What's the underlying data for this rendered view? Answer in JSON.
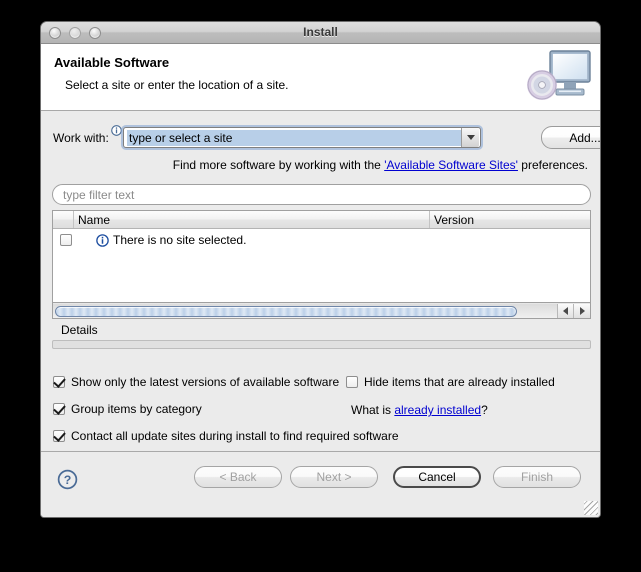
{
  "window": {
    "title": "Install",
    "traffic_lights": [
      "close-button",
      "minimize-button",
      "zoom-button"
    ]
  },
  "banner": {
    "title": "Available Software",
    "subtitle": "Select a site or enter the location of a site.",
    "icon": "computer-disc-icon"
  },
  "work_with": {
    "label": "Work with:",
    "info_icon": "info-icon",
    "combo_value": "type or select a site",
    "combo_placeholder": "type or select a site",
    "dropdown_icon": "chevron-down-icon",
    "add_button": "Add..."
  },
  "hint": {
    "before": "Find more software by working with the ",
    "link": "'Available Software Sites'",
    "after": " preferences."
  },
  "filter": {
    "placeholder": "type filter text",
    "value": ""
  },
  "table": {
    "columns": [
      "",
      "Name",
      "Version"
    ],
    "rows": [
      {
        "checked": false,
        "icon": "info-icon",
        "name": "There is no site selected.",
        "version": ""
      }
    ]
  },
  "scrollbar": {
    "left_arrow": "scroll-left-icon",
    "right_arrow": "scroll-right-icon"
  },
  "details": {
    "label": "Details",
    "value": ""
  },
  "options": [
    {
      "label": "Show only the latest versions of available software",
      "checked": true
    },
    {
      "label": "Group items by category",
      "checked": true
    },
    {
      "label": "Contact all update sites during install to find required software",
      "checked": true
    },
    {
      "label": "Hide items that are already installed",
      "checked": false
    }
  ],
  "what_is": {
    "before": "What is ",
    "link": "already installed",
    "after": "?"
  },
  "footer": {
    "help_icon": "help-question-icon",
    "back": "< Back",
    "next": "Next >",
    "cancel": "Cancel",
    "finish": "Finish",
    "resize_grip": "resize-grip-icon"
  },
  "colors": {
    "link": "#0000d0",
    "selection": "#b8cfe8",
    "window_bg": "#ebebeb",
    "desktop_bg": "#000000"
  }
}
